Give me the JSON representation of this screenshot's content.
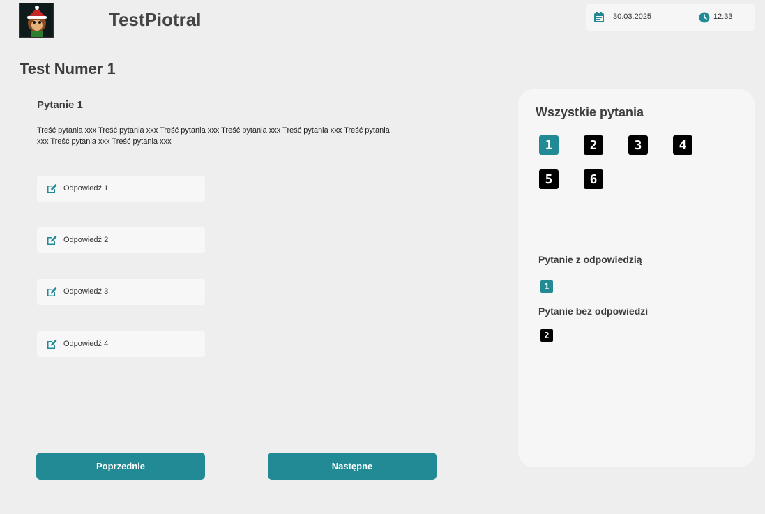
{
  "header": {
    "app_title": "TestPiotral",
    "date": "30.03.2025",
    "time": "12:33",
    "icons": {
      "calendar": "calendar-icon",
      "clock": "clock-icon",
      "logo": "monkey-santa-logo"
    }
  },
  "test": {
    "title": "Test Numer 1",
    "question_title": "Pytanie 1",
    "question_text": "Treść pytania xxx Treść pytania xxx Treść pytania xxx Treść pytania xxx Treść pytania xxx Treść pytania xxx Treść pytania xxx Treść pytania xxx",
    "answers": [
      {
        "label": "Odpowiedź 1",
        "icon": "edit-icon"
      },
      {
        "label": "Odpowiedź 2",
        "icon": "edit-icon"
      },
      {
        "label": "Odpowiedź 3",
        "icon": "edit-icon"
      },
      {
        "label": "Odpowiedź 4",
        "icon": "edit-icon"
      }
    ],
    "prev_label": "Poprzednie",
    "next_label": "Następne"
  },
  "panel": {
    "title": "Wszystkie pytania",
    "questions": [
      {
        "number": "1",
        "answered": true
      },
      {
        "number": "2",
        "answered": false
      },
      {
        "number": "3",
        "answered": false
      },
      {
        "number": "4",
        "answered": false
      },
      {
        "number": "5",
        "answered": false
      },
      {
        "number": "6",
        "answered": false
      }
    ],
    "legend_answered_label": "Pytanie z odpowiedzią",
    "legend_answered_example": "1",
    "legend_unanswered_label": "Pytanie bez odpowiedzi",
    "legend_unanswered_example": "2"
  },
  "colors": {
    "accent": "#218a95",
    "unanswered": "#000000",
    "background": "#eeeeee",
    "card": "#f6f6f6"
  }
}
